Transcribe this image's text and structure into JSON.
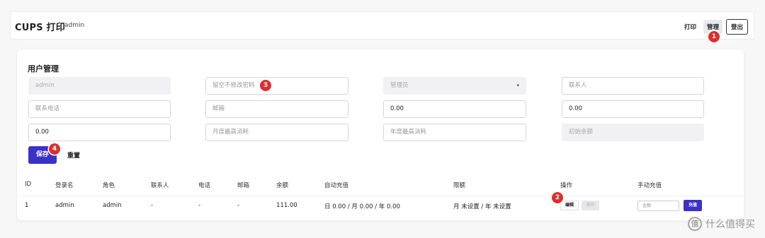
{
  "header": {
    "app_title": "CUPS 打印",
    "username": "admin",
    "nav": {
      "print": "打印",
      "manage": "管理",
      "logout": "登出"
    }
  },
  "form": {
    "title": "用户管理",
    "username_value": "admin",
    "password_placeholder": "留空不修改密码",
    "role_value": "管理员",
    "contact_placeholder": "联系人",
    "phone_placeholder": "联系电话",
    "email_placeholder": "邮箱",
    "field_value_a": "0.00",
    "field_value_b": "0.00",
    "field_value_c": "0.00",
    "monthly_max_placeholder": "月度最高消耗",
    "yearly_max_placeholder": "年度最高消耗",
    "initial_balance_placeholder": "初始余额",
    "save_label": "保存",
    "reset_label": "重置"
  },
  "table": {
    "headers": [
      "ID",
      "登录名",
      "角色",
      "联系人",
      "电话",
      "邮箱",
      "余额",
      "自动充值",
      "限额",
      "操作",
      "手动充值"
    ],
    "rows": [
      {
        "id": "1",
        "login": "admin",
        "role": "admin",
        "contact": "-",
        "phone": "-",
        "email": "-",
        "balance": "111.00",
        "auto_recharge": "日 0.00 / 月 0.00 / 年 0.00",
        "limit": "月 未设置 / 年 未设置",
        "edit_label": "编辑",
        "delete_label": "删除",
        "amount_placeholder": "金额",
        "charge_label": "充值"
      }
    ]
  },
  "annotations": [
    "1",
    "2",
    "3",
    "4"
  ],
  "watermark": {
    "text": "什么值得买",
    "logo_glyph": "值"
  },
  "colors": {
    "primary": "#3b30c8",
    "badge": "#e02d2d"
  }
}
